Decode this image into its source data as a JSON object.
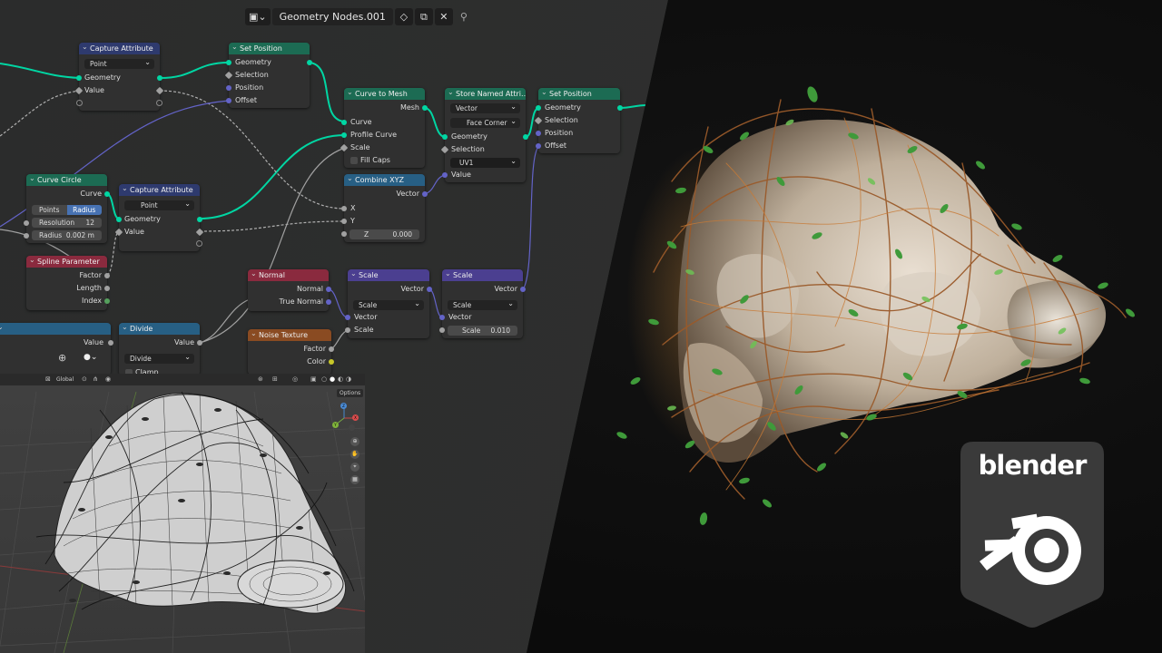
{
  "header": {
    "tree_icon": "node-tree-icon",
    "tree_name": "Geometry Nodes.001",
    "shield": "◇",
    "copy": "⧉",
    "close": "✕",
    "pin": "📌"
  },
  "nodes": {
    "capture1": {
      "title": "Capture Attribute",
      "domain": "Point",
      "geometry": "Geometry",
      "value": "Value"
    },
    "setpos1": {
      "title": "Set Position",
      "geometry": "Geometry",
      "selection": "Selection",
      "position": "Position",
      "offset": "Offset"
    },
    "curve_to_mesh": {
      "title": "Curve to Mesh",
      "mesh": "Mesh",
      "curve": "Curve",
      "profile": "Profile Curve",
      "scale": "Scale",
      "fill_caps": "Fill Caps"
    },
    "store_named": {
      "title": "Store Named Attri...",
      "type": "Vector",
      "domain": "Face Corner",
      "geometry": "Geometry",
      "selection": "Selection",
      "name": "UV1",
      "value": "Value"
    },
    "setpos2": {
      "title": "Set Position",
      "geometry": "Geometry",
      "selection": "Selection",
      "position": "Position",
      "offset": "Offset"
    },
    "curve_circle": {
      "title": "Curve Circle",
      "curve": "Curve",
      "mode_points": "Points",
      "mode_radius": "Radius",
      "resolution_label": "Resolution",
      "resolution": "12",
      "radius_label": "Radius",
      "radius": "0.002 m"
    },
    "capture2": {
      "title": "Capture Attribute",
      "domain": "Point",
      "geometry": "Geometry",
      "value": "Value"
    },
    "combine_xyz": {
      "title": "Combine XYZ",
      "vector": "Vector",
      "x": "X",
      "y": "Y",
      "z_label": "Z",
      "z": "0.000"
    },
    "spline_param": {
      "title": "Spline Parameter",
      "factor": "Factor",
      "length": "Length",
      "index": "Index"
    },
    "normal": {
      "title": "Normal",
      "normal": "Normal",
      "true_normal": "True Normal"
    },
    "scale1": {
      "title": "Scale",
      "vector_out": "Vector",
      "op": "Scale",
      "vector_in": "Vector",
      "scale": "Scale"
    },
    "scale2": {
      "title": "Scale",
      "vector_out": "Vector",
      "op": "Scale",
      "vector_in": "Vector",
      "scale_label": "Scale",
      "scale": "0.010"
    },
    "value_node": {
      "value": "Value"
    },
    "divide": {
      "title": "Divide",
      "value": "Value",
      "op": "Divide",
      "clamp": "Clamp"
    },
    "noise": {
      "title": "Noise Texture",
      "factor": "Factor",
      "color": "Color"
    }
  },
  "viewport": {
    "orientation": "Global",
    "options": "Options",
    "gizmo": {
      "x": "X",
      "y": "Y",
      "z": "Z"
    }
  },
  "logo": {
    "word": "blender"
  },
  "colors": {
    "geometry_header": "#1c6b53",
    "attribute_header": "#2e3a6e",
    "vector_header": "#4b3f90",
    "converter_header": "#275f84",
    "input_header": "#8a2a3e",
    "texture_header": "#8a4b22",
    "geometry_socket": "#00d6a3",
    "vector_socket": "#6363c7",
    "accent_blue": "#4772b3"
  }
}
